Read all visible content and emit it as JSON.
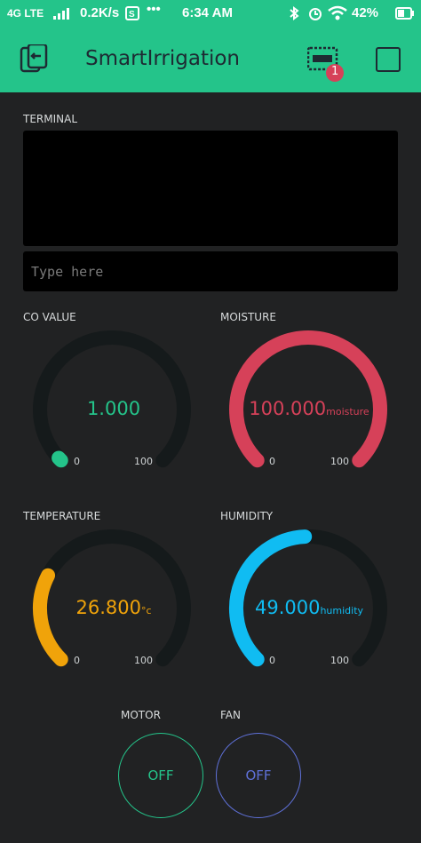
{
  "status_bar": {
    "network": "4G LTE",
    "speed": "0.2K/s",
    "time": "6:34 AM",
    "battery": "42%"
  },
  "app": {
    "title": "SmartIrrigation",
    "badge_count": "1",
    "accent": "#24c48a"
  },
  "terminal": {
    "label": "TERMINAL",
    "input_placeholder": "Type here"
  },
  "gauges": [
    {
      "label": "CO VALUE",
      "value": "1.000",
      "unit": "",
      "min": "0",
      "max": "100",
      "color": "#24c48a",
      "level": 0.01
    },
    {
      "label": "MOISTURE",
      "value": "100.000",
      "unit": "moisture",
      "min": "0",
      "max": "100",
      "color": "#d64159",
      "level": 1.0
    },
    {
      "label": "TEMPERATURE",
      "value": "26.800",
      "unit": "°c",
      "min": "0",
      "max": "100",
      "color": "#f0a30a",
      "level": 0.268
    },
    {
      "label": "HUMIDITY",
      "value": "49.000",
      "unit": "humidity",
      "min": "0",
      "max": "100",
      "color": "#10bcf2",
      "level": 0.49
    }
  ],
  "buttons": [
    {
      "label": "MOTOR",
      "state": "OFF",
      "color": "#24c48a"
    },
    {
      "label": "FAN",
      "state": "OFF",
      "color": "#5f71d9"
    }
  ]
}
